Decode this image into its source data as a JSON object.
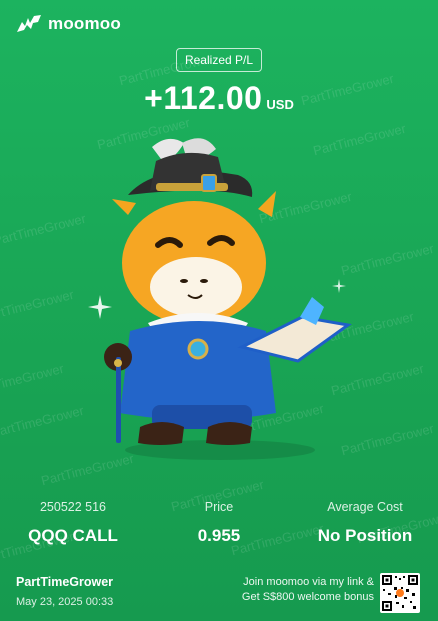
{
  "brand": {
    "name": "moomoo",
    "logo_icon": "bull-logo-icon"
  },
  "pnl": {
    "label": "Realized P/L",
    "amount": "+112.00",
    "currency": "USD"
  },
  "watermark_text": "PartTimeGrower",
  "position": [
    {
      "label": "250522 516",
      "value": "QQQ CALL"
    },
    {
      "label": "Price",
      "value": "0.955"
    },
    {
      "label": "Average Cost",
      "value": "No Position"
    }
  ],
  "footer": {
    "user_name": "PartTimeGrower",
    "timestamp": "May 23, 2025 00:33",
    "promo_line1": "Join moomoo via my link &",
    "promo_line2": "Get S$800 welcome bonus",
    "qr_icon": "qr-code-icon"
  },
  "colors": {
    "background": "#1aa756",
    "text": "#ffffff",
    "mascot_body": "#f5a623",
    "mascot_coat": "#1f5fc8"
  }
}
